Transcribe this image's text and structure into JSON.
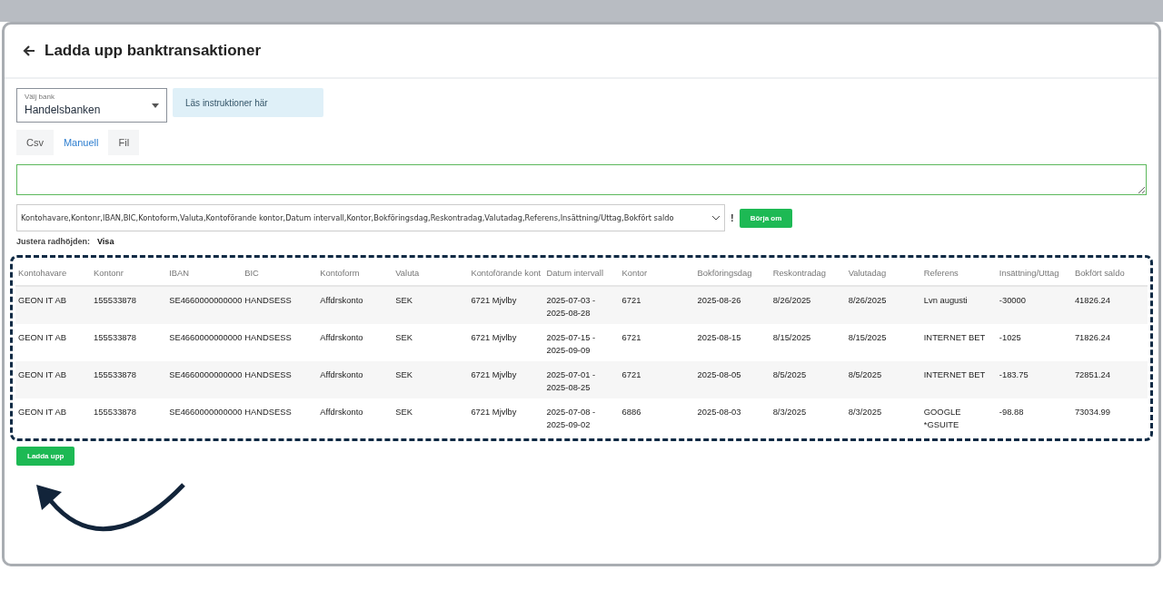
{
  "header": {
    "title": "Ladda upp banktransaktioner"
  },
  "bank_select": {
    "label": "Välj bank",
    "value": "Handelsbanken"
  },
  "info_box": {
    "text": "Läs instruktioner här"
  },
  "tabs": [
    {
      "label": "Csv",
      "selected": false
    },
    {
      "label": "Manuell",
      "selected": true
    },
    {
      "label": "Fil",
      "selected": false
    }
  ],
  "columns_field": {
    "value": "Kontohavare,Kontonr,IBAN,BIC,Kontoform,Valuta,Kontoförande kontor,Datum intervall,Kontor,Bokföringsdag,Reskontradag,Valutadag,Referens,Insättning/Uttag,Bokfört saldo",
    "warning": "!",
    "restart_button": "Börja om"
  },
  "row_height": {
    "label": "Justera radhöjden:",
    "link": "Visa"
  },
  "table": {
    "columns": [
      "Kontohavare",
      "Kontonr",
      "IBAN",
      "BIC",
      "Kontoform",
      "Valuta",
      "Kontoförande kont",
      "Datum intervall",
      "Kontor",
      "Bokföringsdag",
      "Reskontradag",
      "Valutadag",
      "Referens",
      "Insättning/Uttag",
      "Bokfört saldo"
    ],
    "rows": [
      [
        "GEON IT AB",
        "155533878",
        "SE4660000000000",
        "HANDSESS",
        "Affdrskonto",
        "SEK",
        "6721 Mjvlby",
        "2025-07-03 - 2025-08-28",
        "6721",
        "2025-08-26",
        "8/26/2025",
        "8/26/2025",
        "Lvn augusti",
        "-30000",
        "41826.24"
      ],
      [
        "GEON IT AB",
        "155533878",
        "SE4660000000000",
        "HANDSESS",
        "Affdrskonto",
        "SEK",
        "6721 Mjvlby",
        "2025-07-15 - 2025-09-09",
        "6721",
        "2025-08-15",
        "8/15/2025",
        "8/15/2025",
        "INTERNET BET",
        "-1025",
        "71826.24"
      ],
      [
        "GEON IT AB",
        "155533878",
        "SE4660000000000",
        "HANDSESS",
        "Affdrskonto",
        "SEK",
        "6721 Mjvlby",
        "2025-07-01 - 2025-08-25",
        "6721",
        "2025-08-05",
        "8/5/2025",
        "8/5/2025",
        "INTERNET BET",
        "-183.75",
        "72851.24"
      ],
      [
        "GEON IT AB",
        "155533878",
        "SE4660000000000",
        "HANDSESS",
        "Affdrskonto",
        "SEK",
        "6721 Mjvlby",
        "2025-07-08 - 2025-09-02",
        "6886",
        "2025-08-03",
        "8/3/2025",
        "8/3/2025",
        "GOOGLE *GSUITE",
        "-98.88",
        "73034.99"
      ]
    ]
  },
  "upload_button": "Ladda upp"
}
